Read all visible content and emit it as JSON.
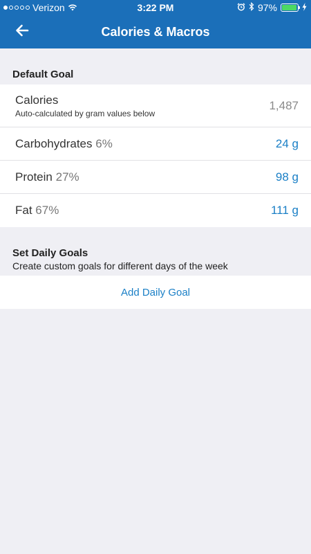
{
  "status_bar": {
    "carrier": "Verizon",
    "time": "3:22 PM",
    "battery_percent": "97%",
    "battery_level": 0.97,
    "signal_bars": 1,
    "icons": [
      "wifi-icon",
      "alarm-icon",
      "bluetooth-icon",
      "battery-icon",
      "charging-icon"
    ]
  },
  "navbar": {
    "title": "Calories & Macros",
    "back_icon": "back-arrow-icon"
  },
  "default_goal": {
    "header": "Default Goal",
    "calories": {
      "label": "Calories",
      "sublabel": "Auto-calculated by gram values below",
      "value": "1,487"
    },
    "macros": [
      {
        "name": "Carbohydrates",
        "percent": "6%",
        "grams": "24 g"
      },
      {
        "name": "Protein",
        "percent": "27%",
        "grams": "98 g"
      },
      {
        "name": "Fat",
        "percent": "67%",
        "grams": "111 g"
      }
    ]
  },
  "daily_goals": {
    "header": "Set Daily Goals",
    "subheader": "Create custom goals for different days of the week",
    "add_label": "Add Daily Goal"
  },
  "colors": {
    "brand": "#1b6fb9",
    "link": "#1a7fc6",
    "background": "#efeff4",
    "battery": "#4cd964"
  }
}
